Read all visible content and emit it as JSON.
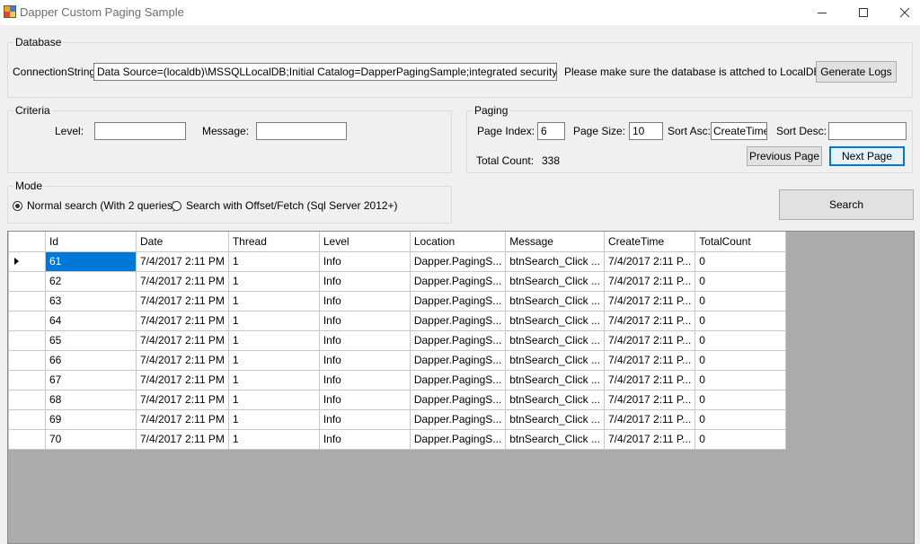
{
  "window": {
    "title": "Dapper Custom Paging Sample"
  },
  "database": {
    "group_label": "Database",
    "connection_label": "ConnectionString:",
    "connection_value": "Data Source=(localdb)\\MSSQLLocalDB;Initial Catalog=DapperPagingSample;integrated security=True;",
    "note": "Please make sure the database is attched to LocalDB.",
    "generate_logs_label": "Generate Logs"
  },
  "criteria": {
    "group_label": "Criteria",
    "level_label": "Level:",
    "level_value": "",
    "message_label": "Message:",
    "message_value": ""
  },
  "paging": {
    "group_label": "Paging",
    "page_index_label": "Page Index:",
    "page_index_value": "6",
    "page_size_label": "Page Size:",
    "page_size_value": "10",
    "sort_asc_label": "Sort Asc:",
    "sort_asc_value": "CreateTime",
    "sort_desc_label": "Sort Desc:",
    "sort_desc_value": "",
    "total_count_label": "Total Count:",
    "total_count_value": "338",
    "previous_label": "Previous Page",
    "next_label": "Next Page"
  },
  "mode": {
    "group_label": "Mode",
    "options": [
      {
        "label": "Normal search (With 2 queries)",
        "checked": true
      },
      {
        "label": "Search with Offset/Fetch (Sql Server 2012+)",
        "checked": false
      }
    ]
  },
  "search_label": "Search",
  "grid": {
    "columns": [
      "Id",
      "Date",
      "Thread",
      "Level",
      "Location",
      "Message",
      "CreateTime",
      "TotalCount"
    ],
    "rows": [
      [
        "61",
        "7/4/2017 2:11 PM",
        "1",
        "Info",
        "Dapper.PagingS...",
        "btnSearch_Click ...",
        "7/4/2017 2:11 P...",
        "0"
      ],
      [
        "62",
        "7/4/2017 2:11 PM",
        "1",
        "Info",
        "Dapper.PagingS...",
        "btnSearch_Click ...",
        "7/4/2017 2:11 P...",
        "0"
      ],
      [
        "63",
        "7/4/2017 2:11 PM",
        "1",
        "Info",
        "Dapper.PagingS...",
        "btnSearch_Click ...",
        "7/4/2017 2:11 P...",
        "0"
      ],
      [
        "64",
        "7/4/2017 2:11 PM",
        "1",
        "Info",
        "Dapper.PagingS...",
        "btnSearch_Click ...",
        "7/4/2017 2:11 P...",
        "0"
      ],
      [
        "65",
        "7/4/2017 2:11 PM",
        "1",
        "Info",
        "Dapper.PagingS...",
        "btnSearch_Click ...",
        "7/4/2017 2:11 P...",
        "0"
      ],
      [
        "66",
        "7/4/2017 2:11 PM",
        "1",
        "Info",
        "Dapper.PagingS...",
        "btnSearch_Click ...",
        "7/4/2017 2:11 P...",
        "0"
      ],
      [
        "67",
        "7/4/2017 2:11 PM",
        "1",
        "Info",
        "Dapper.PagingS...",
        "btnSearch_Click ...",
        "7/4/2017 2:11 P...",
        "0"
      ],
      [
        "68",
        "7/4/2017 2:11 PM",
        "1",
        "Info",
        "Dapper.PagingS...",
        "btnSearch_Click ...",
        "7/4/2017 2:11 P...",
        "0"
      ],
      [
        "69",
        "7/4/2017 2:11 PM",
        "1",
        "Info",
        "Dapper.PagingS...",
        "btnSearch_Click ...",
        "7/4/2017 2:11 P...",
        "0"
      ],
      [
        "70",
        "7/4/2017 2:11 PM",
        "1",
        "Info",
        "Dapper.PagingS...",
        "btnSearch_Click ...",
        "7/4/2017 2:11 P...",
        "0"
      ]
    ]
  },
  "colors": {
    "selection": "#0078d7",
    "grid_background": "#ababab"
  }
}
